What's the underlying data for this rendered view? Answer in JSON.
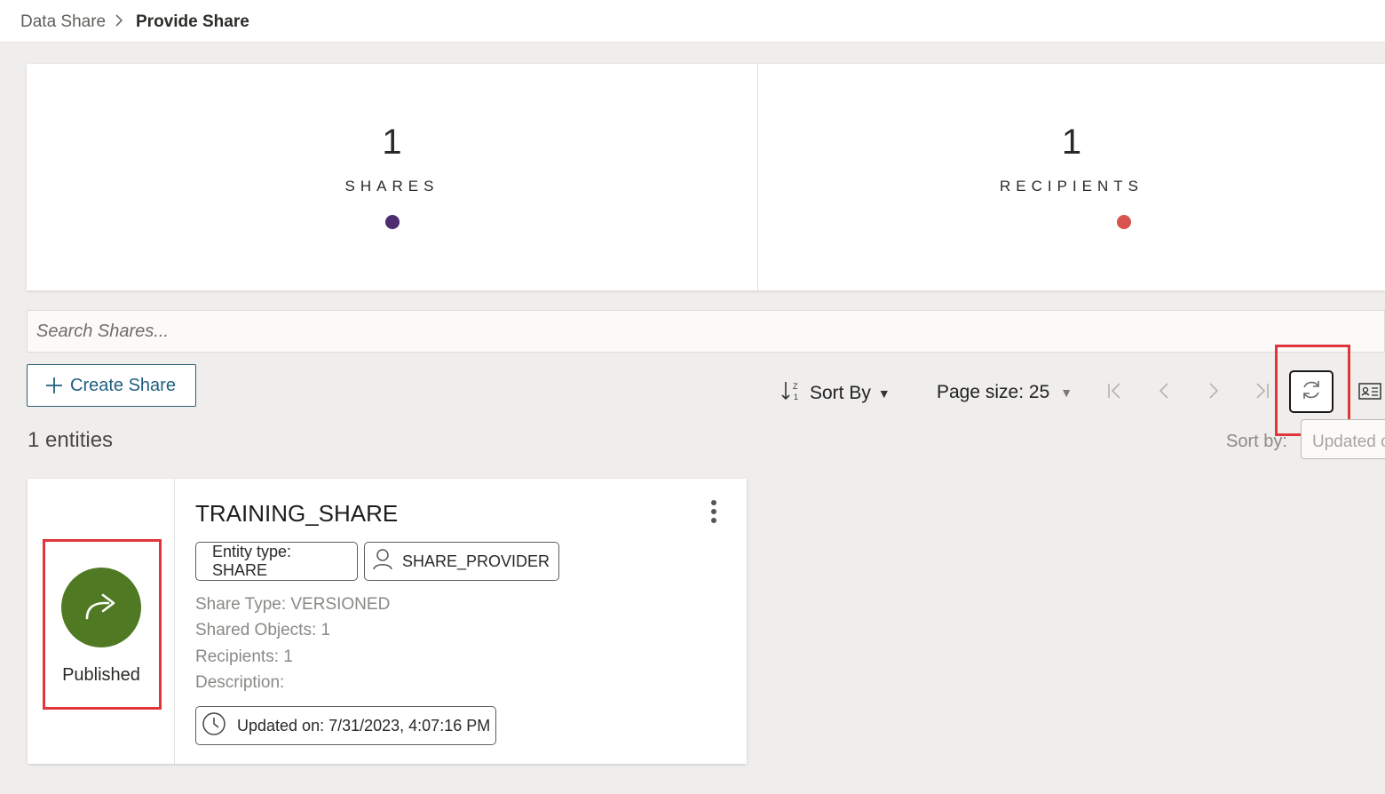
{
  "breadcrumb": {
    "parent": "Data Share",
    "separator": ">",
    "current": "Provide Share"
  },
  "stats": [
    {
      "value": "1",
      "label": "SHARES",
      "color": "#4d2c6f"
    },
    {
      "value": "1",
      "label": "RECIPIENTS",
      "color": "#d9534f"
    }
  ],
  "search": {
    "placeholder": "Search Shares..."
  },
  "toolbar": {
    "create_label": "Create Share",
    "entities_count": "1 entities",
    "sort_label": "Sort By",
    "page_size_label": "Page size: 25",
    "sort_by_label": "Sort by:",
    "sort_by_value": "Updated o"
  },
  "share": {
    "name": "TRAINING_SHARE",
    "status": "Published",
    "status_color": "#4f7a23",
    "entity_type": "Entity type: SHARE",
    "owner": "SHARE_PROVIDER",
    "share_type": "Share Type: VERSIONED",
    "shared_objects": "Shared Objects: 1",
    "recipients": "Recipients: 1",
    "description": "Description:",
    "updated_on": "Updated on: 7/31/2023, 4:07:16 PM"
  },
  "colors": {
    "accent": "#1f5f7d",
    "callout": "#e0353b"
  }
}
